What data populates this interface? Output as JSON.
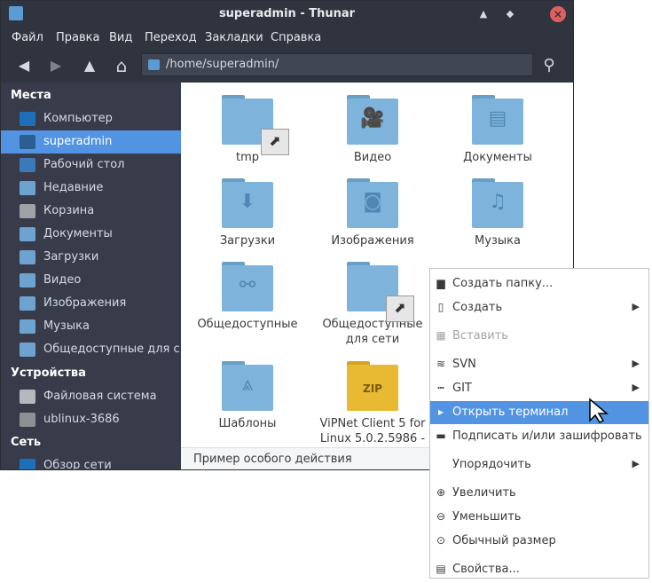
{
  "window": {
    "title": "superadmin - Thunar",
    "minimize_glyph": "▲",
    "maximize_glyph": "◆",
    "close_glyph": "×"
  },
  "menubar": [
    "Файл",
    "Правка",
    "Вид",
    "Переход",
    "Закладки",
    "Справка"
  ],
  "toolbar": {
    "back_glyph": "◀",
    "forward_glyph": "▶",
    "up_glyph": "▲",
    "home_glyph": "⌂",
    "path": "/home/superadmin/",
    "search_glyph": "⚲"
  },
  "sidebar": {
    "sections": {
      "places": "Места",
      "devices": "Устройства",
      "network": "Сеть"
    },
    "places": [
      {
        "label": "Компьютер",
        "icon": "computer-icon",
        "color": "#1e6fb8"
      },
      {
        "label": "superadmin",
        "icon": "home-icon",
        "color": "#2a5f8f",
        "active": true
      },
      {
        "label": "Рабочий стол",
        "icon": "desktop-icon",
        "color": "#3a7ab8"
      },
      {
        "label": "Недавние",
        "icon": "clock-icon",
        "color": "#6fa3cf"
      },
      {
        "label": "Корзина",
        "icon": "trash-icon",
        "color": "#9ea3a8"
      },
      {
        "label": "Документы",
        "icon": "documents-icon",
        "color": "#6fa3cf"
      },
      {
        "label": "Загрузки",
        "icon": "downloads-icon",
        "color": "#6fa3cf"
      },
      {
        "label": "Видео",
        "icon": "video-icon",
        "color": "#6fa3cf"
      },
      {
        "label": "Изображения",
        "icon": "pictures-icon",
        "color": "#6fa3cf"
      },
      {
        "label": "Музыка",
        "icon": "music-icon",
        "color": "#6fa3cf"
      },
      {
        "label": "Общедоступные для с...",
        "icon": "shared-icon",
        "color": "#6fa3cf"
      }
    ],
    "devices": [
      {
        "label": "Файловая система",
        "icon": "drive-icon",
        "color": "#b5b9be"
      },
      {
        "label": "ublinux-3686",
        "icon": "drive-icon",
        "color": "#8d9196"
      }
    ],
    "network": [
      {
        "label": "Обзор сети",
        "icon": "network-icon",
        "color": "#1e6fb8"
      }
    ]
  },
  "files": [
    {
      "label": "tmp",
      "glyph": "",
      "link": true,
      "link_glyph": "⬈"
    },
    {
      "label": "Видео",
      "glyph": "🎥"
    },
    {
      "label": "Документы",
      "glyph": "▤"
    },
    {
      "label": "Загрузки",
      "glyph": "⬇"
    },
    {
      "label": "Изображения",
      "glyph": "◙"
    },
    {
      "label": "Музыка",
      "glyph": "♫"
    },
    {
      "label": "Общедоступные",
      "glyph": "⚯"
    },
    {
      "label": "Общедоступные для сети",
      "glyph": "",
      "link": true,
      "link_glyph": "⬈"
    },
    {
      "label": "",
      "glyph": "",
      "hidden": true
    },
    {
      "label": "Шаблоны",
      "glyph": "⩓"
    },
    {
      "label": "ViPNet Client 5 for Linux 5.0.2.5986 -",
      "glyph": "ZIP",
      "zip": true
    }
  ],
  "statusbar": {
    "text": "Пример особого действия"
  },
  "context_menu": [
    {
      "label": "Создать папку...",
      "icon": "new-folder-icon",
      "glyph": "▆"
    },
    {
      "label": "Создать",
      "icon": "new-document-icon",
      "glyph": "▯",
      "submenu": true
    },
    {
      "label": "Вставить",
      "icon": "paste-icon",
      "glyph": "▦",
      "disabled": true
    },
    {
      "label": "SVN",
      "icon": "svn-icon",
      "glyph": "≋",
      "submenu": true
    },
    {
      "label": "GIT",
      "icon": "git-icon",
      "glyph": "┅",
      "submenu": true
    },
    {
      "label": "Открыть терминал",
      "icon": "terminal-icon",
      "glyph": "▸",
      "highlighted": true
    },
    {
      "label": "Подписать и/или зашифровать",
      "icon": "sign-icon",
      "glyph": "▬"
    },
    {
      "label": "Упорядочить",
      "icon": "",
      "glyph": "",
      "submenu": true
    },
    {
      "label": "Увеличить",
      "icon": "zoom-in-icon",
      "glyph": "⊕"
    },
    {
      "label": "Уменьшить",
      "icon": "zoom-out-icon",
      "glyph": "⊖"
    },
    {
      "label": "Обычный размер",
      "icon": "zoom-original-icon",
      "glyph": "⊙"
    },
    {
      "label": "Свойства...",
      "icon": "properties-icon",
      "glyph": "▤"
    }
  ],
  "submenu_arrow": "▶",
  "colors": {
    "accent": "#5294e2",
    "sidebar_bg": "#383c4a",
    "titlebar_bg": "#2f343f"
  }
}
